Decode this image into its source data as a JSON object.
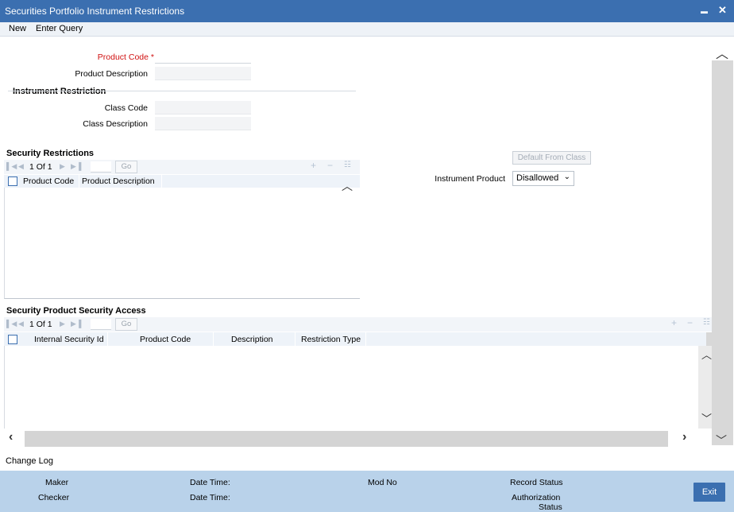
{
  "window": {
    "title": "Securities Portfolio Instrument Restrictions",
    "minimize_glyph": "▬",
    "close_glyph": "✕"
  },
  "menu": {
    "new_label": "New",
    "enter_query_label": "Enter Query"
  },
  "header_fields": {
    "product_code_label": "Product Code",
    "required_mark": "*",
    "product_code_value": "",
    "product_description_label": "Product Description",
    "product_description_value": ""
  },
  "instrument_restriction": {
    "section_title": "Instrument Restriction",
    "class_code_label": "Class Code",
    "class_code_value": "",
    "class_description_label": "Class Description",
    "class_description_value": ""
  },
  "security_restrictions": {
    "section_title": "Security Restrictions",
    "pager_text": "1 Of 1",
    "go_label": "Go",
    "columns": [
      "Product Code",
      "Product Description"
    ],
    "rows": []
  },
  "right_panel": {
    "default_from_class_label": "Default From Class",
    "instrument_product_label": "Instrument Product",
    "instrument_product_value": "Disallowed"
  },
  "security_access": {
    "section_title": "Security Product Security Access",
    "pager_text": "1 Of 1",
    "go_label": "Go",
    "columns": [
      "Internal Security Id",
      "Product Code",
      "Description",
      "Restriction Type"
    ],
    "rows": []
  },
  "footer": {
    "change_log_label": "Change Log",
    "maker_label": "Maker",
    "checker_label": "Checker",
    "date_time_label_1": "Date Time:",
    "date_time_label_2": "Date Time:",
    "mod_no_label": "Mod No",
    "record_status_label": "Record Status",
    "authorization_status_label_1": "Authorization",
    "authorization_status_label_2": "Status",
    "exit_label": "Exit"
  },
  "colors": {
    "title_bar": "#3b6fb0",
    "footer": "#b9d2ea",
    "required": "#d01010"
  }
}
